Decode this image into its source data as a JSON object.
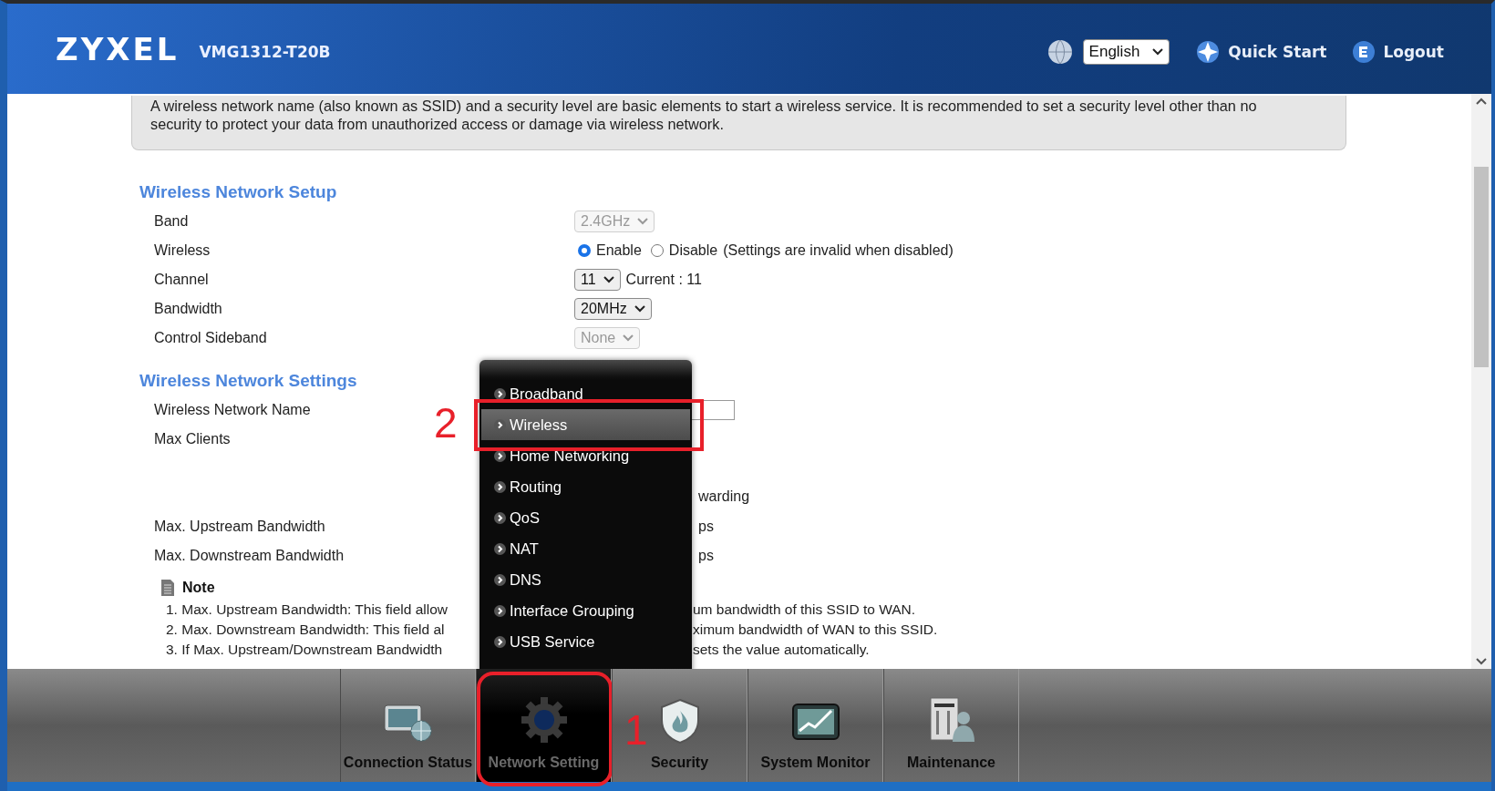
{
  "header": {
    "logo": "ZYXEL",
    "model": "VMG1312-T20B",
    "language": "English",
    "links": [
      {
        "label": "Quick Start",
        "kind": "quickstart"
      },
      {
        "label": "Logout",
        "kind": "logout"
      }
    ]
  },
  "intro": "A wireless network name (also known as SSID) and a security level are basic elements to start a wireless service. It is recommended to set a security level other than no security to protect your data from unauthorized access or damage via wireless network.",
  "setup": {
    "title": "Wireless Network Setup",
    "rows": [
      {
        "label": "Band",
        "kind": "select",
        "value": "2.4GHz",
        "disabled": true
      },
      {
        "label": "Wireless",
        "kind": "radio",
        "options": [
          {
            "label": "Enable",
            "selected": true
          },
          {
            "label": "Disable",
            "selected": false
          }
        ],
        "hint": "(Settings are invalid when disabled)"
      },
      {
        "label": "Channel",
        "kind": "select",
        "value": "11",
        "disabled": false,
        "after": "Current  : 11"
      },
      {
        "label": "Bandwidth",
        "kind": "select",
        "value": "20MHz",
        "disabled": false
      },
      {
        "label": "Control Sideband",
        "kind": "select",
        "value": "None",
        "disabled": true
      }
    ]
  },
  "settings": {
    "title": "Wireless Network Settings",
    "rows": [
      {
        "label": "Wireless Network Name",
        "kind": "input"
      },
      {
        "label": "Max Clients",
        "kind": "covered"
      },
      {
        "kind": "fragment",
        "value": "warding"
      },
      {
        "label": "Max. Upstream Bandwidth",
        "kind": "fragment",
        "value": "ps"
      },
      {
        "label": "Max. Downstream Bandwidth",
        "kind": "fragment",
        "value": "ps"
      }
    ]
  },
  "note": {
    "title": "Note",
    "lines": [
      {
        "start": "1. Max. Upstream Bandwidth: This field allow",
        "end": "um bandwidth of this SSID to WAN."
      },
      {
        "start": "2. Max. Downstream Bandwidth: This field al",
        "end": "ximum bandwidth of WAN to this SSID."
      },
      {
        "start": "3. If Max. Upstream/Downstream Bandwidth",
        "end": "sets the value automatically."
      }
    ]
  },
  "menu": {
    "annotation": "2",
    "items": [
      {
        "label": "Broadband",
        "selected": false
      },
      {
        "label": "Wireless",
        "selected": true
      },
      {
        "label": "Home Networking",
        "selected": false
      },
      {
        "label": "Routing",
        "selected": false
      },
      {
        "label": "QoS",
        "selected": false
      },
      {
        "label": "NAT",
        "selected": false
      },
      {
        "label": "DNS",
        "selected": false
      },
      {
        "label": "Interface Grouping",
        "selected": false
      },
      {
        "label": "USB Service",
        "selected": false
      }
    ]
  },
  "bottom_nav": {
    "annotation": "1",
    "items": [
      {
        "label": "Connection Status",
        "kind": "status",
        "selected": false
      },
      {
        "label": "Network Setting",
        "kind": "network",
        "selected": true
      },
      {
        "label": "Security",
        "kind": "security",
        "selected": false
      },
      {
        "label": "System Monitor",
        "kind": "monitor",
        "selected": false
      },
      {
        "label": "Maintenance",
        "kind": "maintenance",
        "selected": false
      }
    ]
  }
}
